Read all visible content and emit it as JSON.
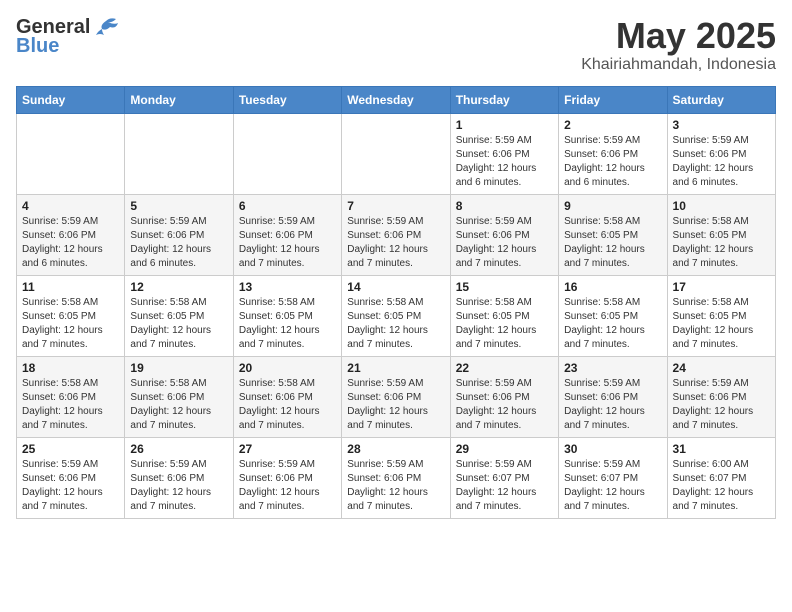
{
  "logo": {
    "general": "General",
    "blue": "Blue"
  },
  "title": "May 2025",
  "subtitle": "Khairiahmandah, Indonesia",
  "weekdays": [
    "Sunday",
    "Monday",
    "Tuesday",
    "Wednesday",
    "Thursday",
    "Friday",
    "Saturday"
  ],
  "weeks": [
    [
      {
        "day": "",
        "info": ""
      },
      {
        "day": "",
        "info": ""
      },
      {
        "day": "",
        "info": ""
      },
      {
        "day": "",
        "info": ""
      },
      {
        "day": "1",
        "info": "Sunrise: 5:59 AM\nSunset: 6:06 PM\nDaylight: 12 hours\nand 6 minutes."
      },
      {
        "day": "2",
        "info": "Sunrise: 5:59 AM\nSunset: 6:06 PM\nDaylight: 12 hours\nand 6 minutes."
      },
      {
        "day": "3",
        "info": "Sunrise: 5:59 AM\nSunset: 6:06 PM\nDaylight: 12 hours\nand 6 minutes."
      }
    ],
    [
      {
        "day": "4",
        "info": "Sunrise: 5:59 AM\nSunset: 6:06 PM\nDaylight: 12 hours\nand 6 minutes."
      },
      {
        "day": "5",
        "info": "Sunrise: 5:59 AM\nSunset: 6:06 PM\nDaylight: 12 hours\nand 6 minutes."
      },
      {
        "day": "6",
        "info": "Sunrise: 5:59 AM\nSunset: 6:06 PM\nDaylight: 12 hours\nand 7 minutes."
      },
      {
        "day": "7",
        "info": "Sunrise: 5:59 AM\nSunset: 6:06 PM\nDaylight: 12 hours\nand 7 minutes."
      },
      {
        "day": "8",
        "info": "Sunrise: 5:59 AM\nSunset: 6:06 PM\nDaylight: 12 hours\nand 7 minutes."
      },
      {
        "day": "9",
        "info": "Sunrise: 5:58 AM\nSunset: 6:05 PM\nDaylight: 12 hours\nand 7 minutes."
      },
      {
        "day": "10",
        "info": "Sunrise: 5:58 AM\nSunset: 6:05 PM\nDaylight: 12 hours\nand 7 minutes."
      }
    ],
    [
      {
        "day": "11",
        "info": "Sunrise: 5:58 AM\nSunset: 6:05 PM\nDaylight: 12 hours\nand 7 minutes."
      },
      {
        "day": "12",
        "info": "Sunrise: 5:58 AM\nSunset: 6:05 PM\nDaylight: 12 hours\nand 7 minutes."
      },
      {
        "day": "13",
        "info": "Sunrise: 5:58 AM\nSunset: 6:05 PM\nDaylight: 12 hours\nand 7 minutes."
      },
      {
        "day": "14",
        "info": "Sunrise: 5:58 AM\nSunset: 6:05 PM\nDaylight: 12 hours\nand 7 minutes."
      },
      {
        "day": "15",
        "info": "Sunrise: 5:58 AM\nSunset: 6:05 PM\nDaylight: 12 hours\nand 7 minutes."
      },
      {
        "day": "16",
        "info": "Sunrise: 5:58 AM\nSunset: 6:05 PM\nDaylight: 12 hours\nand 7 minutes."
      },
      {
        "day": "17",
        "info": "Sunrise: 5:58 AM\nSunset: 6:05 PM\nDaylight: 12 hours\nand 7 minutes."
      }
    ],
    [
      {
        "day": "18",
        "info": "Sunrise: 5:58 AM\nSunset: 6:06 PM\nDaylight: 12 hours\nand 7 minutes."
      },
      {
        "day": "19",
        "info": "Sunrise: 5:58 AM\nSunset: 6:06 PM\nDaylight: 12 hours\nand 7 minutes."
      },
      {
        "day": "20",
        "info": "Sunrise: 5:58 AM\nSunset: 6:06 PM\nDaylight: 12 hours\nand 7 minutes."
      },
      {
        "day": "21",
        "info": "Sunrise: 5:59 AM\nSunset: 6:06 PM\nDaylight: 12 hours\nand 7 minutes."
      },
      {
        "day": "22",
        "info": "Sunrise: 5:59 AM\nSunset: 6:06 PM\nDaylight: 12 hours\nand 7 minutes."
      },
      {
        "day": "23",
        "info": "Sunrise: 5:59 AM\nSunset: 6:06 PM\nDaylight: 12 hours\nand 7 minutes."
      },
      {
        "day": "24",
        "info": "Sunrise: 5:59 AM\nSunset: 6:06 PM\nDaylight: 12 hours\nand 7 minutes."
      }
    ],
    [
      {
        "day": "25",
        "info": "Sunrise: 5:59 AM\nSunset: 6:06 PM\nDaylight: 12 hours\nand 7 minutes."
      },
      {
        "day": "26",
        "info": "Sunrise: 5:59 AM\nSunset: 6:06 PM\nDaylight: 12 hours\nand 7 minutes."
      },
      {
        "day": "27",
        "info": "Sunrise: 5:59 AM\nSunset: 6:06 PM\nDaylight: 12 hours\nand 7 minutes."
      },
      {
        "day": "28",
        "info": "Sunrise: 5:59 AM\nSunset: 6:06 PM\nDaylight: 12 hours\nand 7 minutes."
      },
      {
        "day": "29",
        "info": "Sunrise: 5:59 AM\nSunset: 6:07 PM\nDaylight: 12 hours\nand 7 minutes."
      },
      {
        "day": "30",
        "info": "Sunrise: 5:59 AM\nSunset: 6:07 PM\nDaylight: 12 hours\nand 7 minutes."
      },
      {
        "day": "31",
        "info": "Sunrise: 6:00 AM\nSunset: 6:07 PM\nDaylight: 12 hours\nand 7 minutes."
      }
    ]
  ]
}
